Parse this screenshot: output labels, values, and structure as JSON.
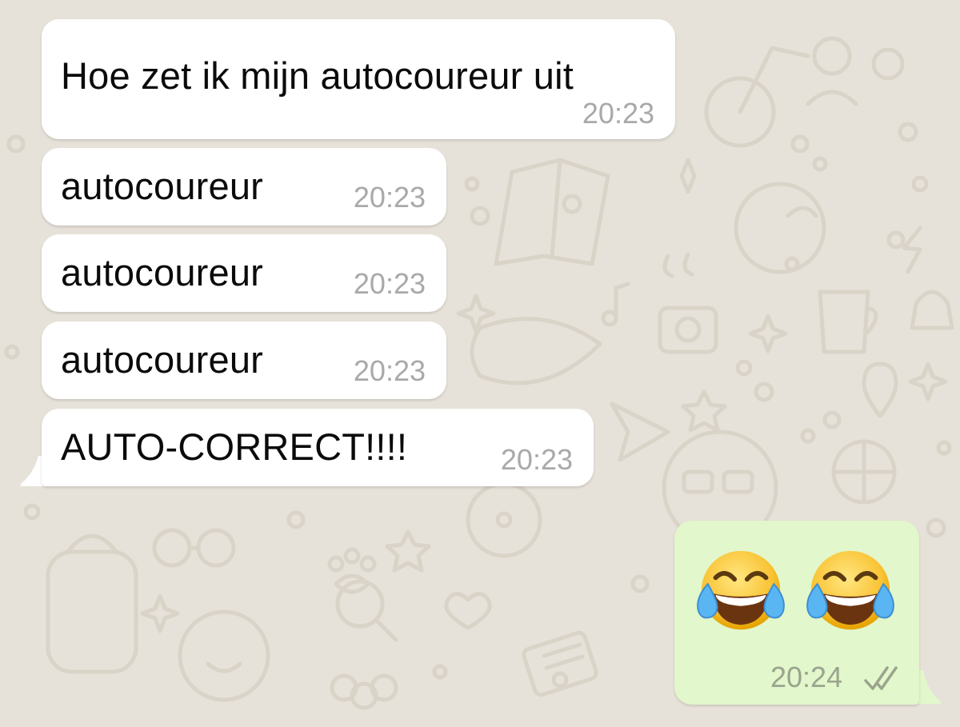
{
  "theme": {
    "wallpaper": "#e7e2d9",
    "incoming_bubble": "#ffffff",
    "outgoing_bubble": "#e2f7cb",
    "text": "#0b0b0b",
    "timestamp": "#a9a9a9"
  },
  "messages": [
    {
      "direction": "incoming",
      "text": "Hoe zet ik mijn autocoureur uit",
      "time": "20:23"
    },
    {
      "direction": "incoming",
      "text": "autocoureur",
      "time": "20:23"
    },
    {
      "direction": "incoming",
      "text": "autocoureur",
      "time": "20:23"
    },
    {
      "direction": "incoming",
      "text": "autocoureur",
      "time": "20:23"
    },
    {
      "direction": "incoming",
      "text": "AUTO-CORRECT!!!!",
      "time": "20:23"
    },
    {
      "direction": "outgoing",
      "emojis": [
        "face-with-tears-of-joy-icon",
        "face-with-tears-of-joy-icon"
      ],
      "time": "20:24",
      "status": "read-double-check-icon"
    }
  ]
}
